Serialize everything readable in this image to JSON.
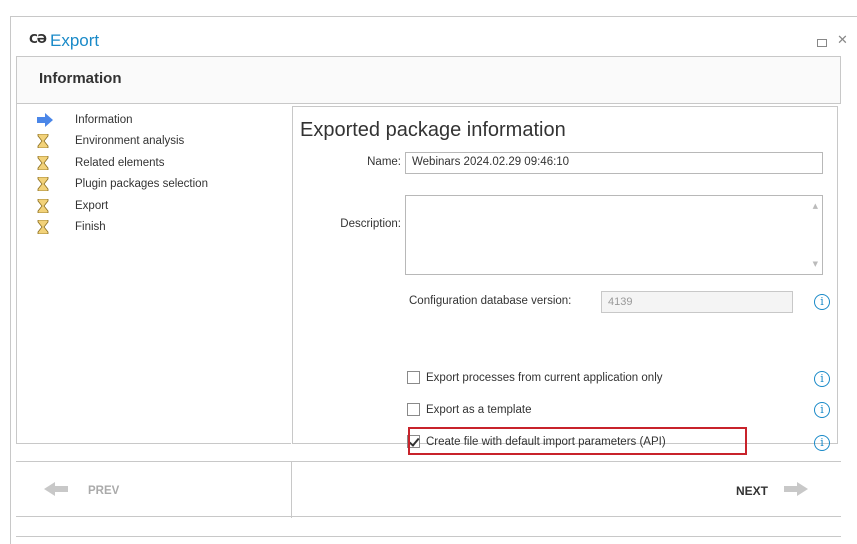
{
  "window": {
    "logo_text": "CƏ",
    "title": "Export",
    "colors": {
      "accent": "#1a8ac8",
      "highlight": "#c8232b",
      "step_arrow": "#4a86e8"
    }
  },
  "header": {
    "title": "Information"
  },
  "steps": [
    {
      "label": "Information",
      "icon": "arrow-right-icon"
    },
    {
      "label": "Environment analysis",
      "icon": "hourglass-icon"
    },
    {
      "label": "Related elements",
      "icon": "hourglass-icon"
    },
    {
      "label": "Plugin packages selection",
      "icon": "hourglass-icon"
    },
    {
      "label": "Export",
      "icon": "hourglass-icon"
    },
    {
      "label": "Finish",
      "icon": "hourglass-icon"
    }
  ],
  "content": {
    "title": "Exported package information",
    "name_label": "Name:",
    "name_value": "Webinars 2024.02.29 09:46:10",
    "description_label": "Description:",
    "description_value": "",
    "config_version_label": "Configuration database version:",
    "config_version_value": "4139",
    "options": [
      {
        "label": "Export processes from current application only",
        "checked": false
      },
      {
        "label": "Export as a template",
        "checked": false
      },
      {
        "label": "Create file with default import parameters (API)",
        "checked": true
      }
    ],
    "info_glyph": "i"
  },
  "footer": {
    "prev_label": "PREV",
    "next_label": "NEXT"
  }
}
